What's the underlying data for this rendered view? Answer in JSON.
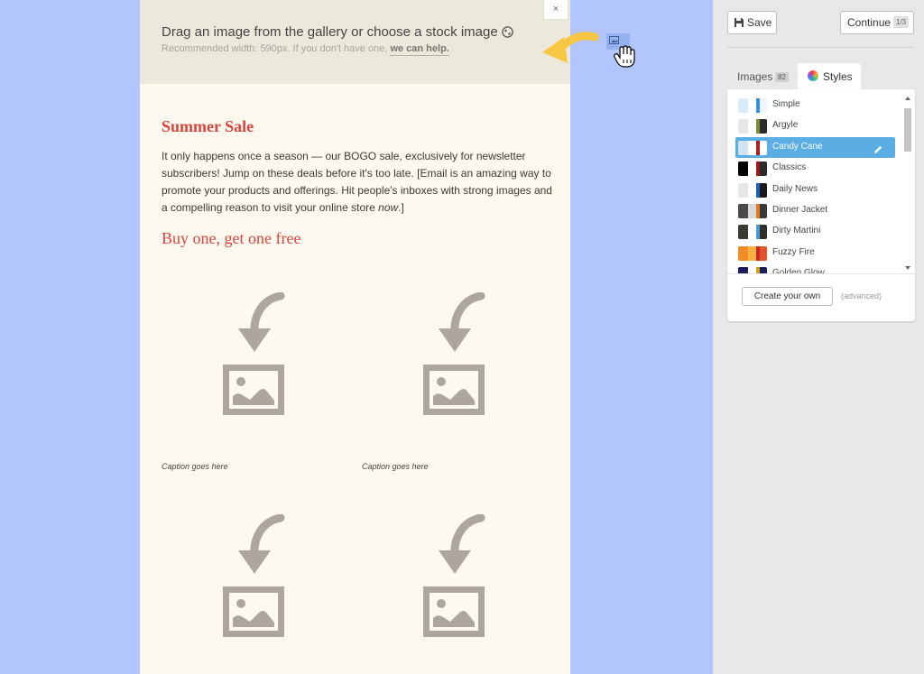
{
  "banner": {
    "title": "Drag an image from the gallery or choose a stock image",
    "subtitle": "Recommended width: 590px. If you don't have one,",
    "help_link": "we can help.",
    "close_label": "×"
  },
  "content": {
    "headline": "Summer Sale",
    "body_before": "It only happens once a season — our BOGO sale, exclusively for newsletter subscribers! Jump on these deals before it's too late. [Email is an amazing way to promote your products and offerings. Hit people's inboxes with strong images and a compelling reason to visit your online store ",
    "body_emphasis": "now",
    "body_after": ".]",
    "subhead": "Buy one, get one free",
    "captions": [
      "Caption goes here",
      "Caption goes here"
    ]
  },
  "toolbar": {
    "save_label": "Save",
    "continue_label": "Continue",
    "step": "1/3"
  },
  "tabs": {
    "images_label": "Images",
    "images_count": "82",
    "styles_label": "Styles"
  },
  "styles": {
    "items": [
      {
        "name": "Simple",
        "colors": [
          "#d6ecfb",
          "#ffffff",
          "#3b8fd6",
          "#eef6fc"
        ]
      },
      {
        "name": "Argyle",
        "colors": [
          "#e6e6e6",
          "#ffffff",
          "#7b8a39",
          "#2b2b2b"
        ]
      },
      {
        "name": "Candy Cane",
        "colors": [
          "#cfe3f5",
          "#ffffff",
          "#b21c1c",
          "#ffffff"
        ]
      },
      {
        "name": "Classics",
        "colors": [
          "#000000",
          "#ffffff",
          "#9b1b1b",
          "#2b2b2b"
        ]
      },
      {
        "name": "Daily News",
        "colors": [
          "#e6e6e6",
          "#ffffff",
          "#1f5fb8",
          "#1a1a1a"
        ]
      },
      {
        "name": "Dinner Jacket",
        "colors": [
          "#4a4a4a",
          "#d9d9d9",
          "#e07a2a",
          "#3a3a3a"
        ]
      },
      {
        "name": "Dirty Martini",
        "colors": [
          "#3b3b32",
          "#ffffff",
          "#4a9ad6",
          "#2f2f28"
        ]
      },
      {
        "name": "Fuzzy Fire",
        "colors": [
          "#f28c28",
          "#f5b041",
          "#c62828",
          "#e2552b"
        ]
      },
      {
        "name": "Golden Glow",
        "colors": [
          "#1c1f5e",
          "#ffffff",
          "#d4a017",
          "#1c1f5e"
        ]
      }
    ],
    "selected": "Candy Cane",
    "create_label": "Create your own",
    "advanced_label": "(advanced)"
  },
  "colors": {
    "background": "#b2c6fd",
    "headline": "#d8443e",
    "selection": "#5aaee3",
    "placeholder_icon": "#aca69f"
  }
}
